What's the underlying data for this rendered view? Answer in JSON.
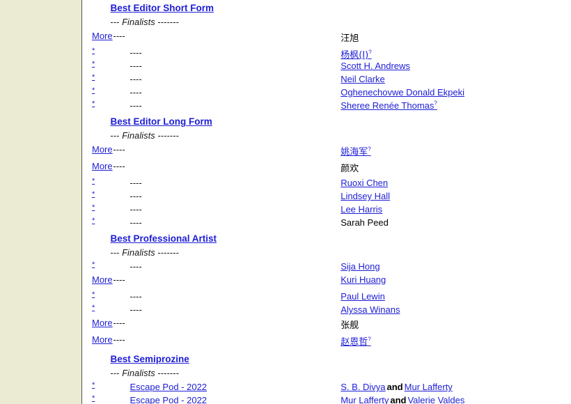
{
  "page": {
    "sidebar_color": "#ebebd3",
    "link_color": "#1d1dd6",
    "text_color": "#000000"
  },
  "labels": {
    "finalists_prefix": "---",
    "finalists_word": "Finalists",
    "finalists_suffix": "-------",
    "more": "More",
    "star": "*",
    "dashes": "----",
    "conjunction": "and",
    "uncertain_marker": "?"
  },
  "sections": [
    {
      "title": "Best Editor Short Form",
      "rows": [
        {
          "mark": "More",
          "work": "----",
          "person": "汪旭",
          "person_link": false,
          "sup": ""
        },
        {
          "mark": "*",
          "work": "----",
          "person": "杨枫(I)",
          "person_link": true,
          "sup": "?"
        },
        {
          "mark": "*",
          "work": "----",
          "person": "Scott H. Andrews",
          "person_link": true,
          "sup": ""
        },
        {
          "mark": "*",
          "work": "----",
          "person": "Neil Clarke",
          "person_link": true,
          "sup": ""
        },
        {
          "mark": "*",
          "work": "----",
          "person": "Oghenechovwe Donald Ekpeki",
          "person_link": true,
          "sup": ""
        },
        {
          "mark": "*",
          "work": "----",
          "person": "Sheree Renée Thomas",
          "person_link": true,
          "sup": "?"
        }
      ]
    },
    {
      "title": "Best Editor Long Form",
      "rows": [
        {
          "mark": "More",
          "work": "----",
          "person": "姚海军",
          "person_link": true,
          "sup": "?"
        },
        {
          "mark": "More",
          "work": "----",
          "person": "颜欢",
          "person_link": false,
          "sup": ""
        },
        {
          "mark": "*",
          "work": "----",
          "person": "Ruoxi Chen",
          "person_link": true,
          "sup": ""
        },
        {
          "mark": "*",
          "work": "----",
          "person": "Lindsey Hall",
          "person_link": true,
          "sup": ""
        },
        {
          "mark": "*",
          "work": "----",
          "person": "Lee Harris",
          "person_link": true,
          "sup": ""
        },
        {
          "mark": "*",
          "work": "----",
          "person": "Sarah Peed",
          "person_link": false,
          "sup": ""
        }
      ]
    },
    {
      "title": "Best Professional Artist",
      "rows": [
        {
          "mark": "*",
          "work": "----",
          "person": "Sija Hong",
          "person_link": true,
          "sup": ""
        },
        {
          "mark": "More",
          "work": "----",
          "person": "Kuri Huang",
          "person_link": true,
          "sup": ""
        },
        {
          "mark": "*",
          "work": "----",
          "person": "Paul Lewin",
          "person_link": true,
          "sup": ""
        },
        {
          "mark": "*",
          "work": "----",
          "person": "Alyssa Winans",
          "person_link": true,
          "sup": ""
        },
        {
          "mark": "More",
          "work": "----",
          "person": "张舰",
          "person_link": false,
          "sup": ""
        },
        {
          "mark": "More",
          "work": "----",
          "person": "赵恩哲",
          "person_link": true,
          "sup": "?"
        }
      ]
    },
    {
      "title": "Best Semiprozine",
      "rows": [
        {
          "mark": "*",
          "work": "Escape Pod - 2022",
          "work_link": true,
          "person": "S. B. Divya",
          "person_link": true,
          "sup": "",
          "person2": "Mur Lafferty",
          "person2_link": true
        },
        {
          "mark": "*",
          "work": "Escape Pod - 2022",
          "work_link": true,
          "person": "Mur Lafferty",
          "person_link": true,
          "sup": "",
          "person2": "Valerie Valdes",
          "person2_link": true
        }
      ]
    }
  ]
}
